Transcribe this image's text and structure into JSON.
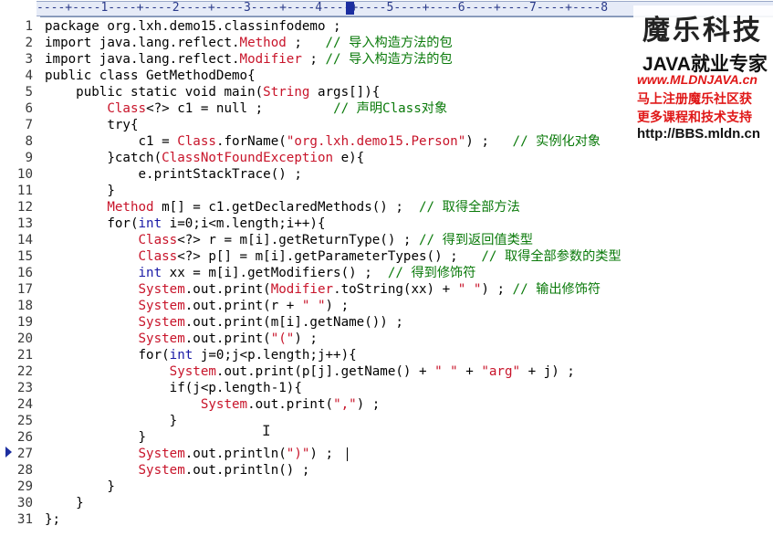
{
  "ruler": {
    "text": "----+----1----+----2----+----3----+----4----+----5----+----6----+----7----+----8"
  },
  "watermark": {
    "logo": "魔乐科技",
    "java": "JAVA就业专家",
    "url": "www.MLDNJAVA.cn",
    "line1": "马上注册魔乐社区获",
    "line2": "更多课程和技术支持",
    "bbs": "http://BBS.mldn.cn"
  },
  "editor": {
    "bookmark_line": 27,
    "lines": [
      {
        "n": "1",
        "seg": [
          {
            "t": "package org.lxh.demo15.classinfodemo ;",
            "c": ""
          }
        ]
      },
      {
        "n": "2",
        "seg": [
          {
            "t": "import java.lang.reflect.",
            "c": ""
          },
          {
            "t": "Method",
            "c": "ty"
          },
          {
            "t": " ;   ",
            "c": ""
          },
          {
            "t": "// 导入构造方法的包",
            "c": "cm"
          }
        ]
      },
      {
        "n": "3",
        "seg": [
          {
            "t": "import java.lang.reflect.",
            "c": ""
          },
          {
            "t": "Modifier",
            "c": "ty"
          },
          {
            "t": " ; ",
            "c": ""
          },
          {
            "t": "// 导入构造方法的包",
            "c": "cm"
          }
        ]
      },
      {
        "n": "4",
        "seg": [
          {
            "t": "public class GetMethodDemo{",
            "c": ""
          }
        ]
      },
      {
        "n": "5",
        "seg": [
          {
            "t": "    public static void main(",
            "c": ""
          },
          {
            "t": "String",
            "c": "ty"
          },
          {
            "t": " args[]){",
            "c": ""
          }
        ]
      },
      {
        "n": "6",
        "seg": [
          {
            "t": "        ",
            "c": ""
          },
          {
            "t": "Class",
            "c": "ty"
          },
          {
            "t": "<?> c1 = null ;         ",
            "c": ""
          },
          {
            "t": "// 声明Class对象",
            "c": "cm"
          }
        ]
      },
      {
        "n": "7",
        "seg": [
          {
            "t": "        try{",
            "c": ""
          }
        ]
      },
      {
        "n": "8",
        "seg": [
          {
            "t": "            c1 = ",
            "c": ""
          },
          {
            "t": "Class",
            "c": "ty"
          },
          {
            "t": ".forName(",
            "c": ""
          },
          {
            "t": "\"org.lxh.demo15.Person\"",
            "c": "st"
          },
          {
            "t": ") ;   ",
            "c": ""
          },
          {
            "t": "// 实例化对象",
            "c": "cm"
          }
        ]
      },
      {
        "n": "9",
        "seg": [
          {
            "t": "        }catch(",
            "c": ""
          },
          {
            "t": "ClassNotFoundException",
            "c": "ty"
          },
          {
            "t": " e){",
            "c": ""
          }
        ]
      },
      {
        "n": "10",
        "seg": [
          {
            "t": "            e.printStackTrace() ;",
            "c": ""
          }
        ]
      },
      {
        "n": "11",
        "seg": [
          {
            "t": "        }",
            "c": ""
          }
        ]
      },
      {
        "n": "12",
        "seg": [
          {
            "t": "        ",
            "c": ""
          },
          {
            "t": "Method",
            "c": "ty"
          },
          {
            "t": " m[] = c1.getDeclaredMethods() ;  ",
            "c": ""
          },
          {
            "t": "// 取得全部方法",
            "c": "cm"
          }
        ]
      },
      {
        "n": "13",
        "seg": [
          {
            "t": "        for(",
            "c": ""
          },
          {
            "t": "int",
            "c": "kw"
          },
          {
            "t": " i=0;i<m.length;i++){",
            "c": ""
          }
        ]
      },
      {
        "n": "14",
        "seg": [
          {
            "t": "            ",
            "c": ""
          },
          {
            "t": "Class",
            "c": "ty"
          },
          {
            "t": "<?> r = m[i].getReturnType() ; ",
            "c": ""
          },
          {
            "t": "// 得到返回值类型",
            "c": "cm"
          }
        ]
      },
      {
        "n": "15",
        "seg": [
          {
            "t": "            ",
            "c": ""
          },
          {
            "t": "Class",
            "c": "ty"
          },
          {
            "t": "<?> p[] = m[i].getParameterTypes() ;   ",
            "c": ""
          },
          {
            "t": "// 取得全部参数的类型",
            "c": "cm"
          }
        ]
      },
      {
        "n": "16",
        "seg": [
          {
            "t": "            ",
            "c": ""
          },
          {
            "t": "int",
            "c": "kw"
          },
          {
            "t": " xx = m[i].getModifiers() ;  ",
            "c": ""
          },
          {
            "t": "// 得到修饰符",
            "c": "cm"
          }
        ]
      },
      {
        "n": "17",
        "seg": [
          {
            "t": "            ",
            "c": ""
          },
          {
            "t": "System",
            "c": "ty"
          },
          {
            "t": ".out.print(",
            "c": ""
          },
          {
            "t": "Modifier",
            "c": "ty"
          },
          {
            "t": ".toString(xx) + ",
            "c": ""
          },
          {
            "t": "\" \"",
            "c": "st"
          },
          {
            "t": ") ; ",
            "c": ""
          },
          {
            "t": "// 输出修饰符",
            "c": "cm"
          }
        ]
      },
      {
        "n": "18",
        "seg": [
          {
            "t": "            ",
            "c": ""
          },
          {
            "t": "System",
            "c": "ty"
          },
          {
            "t": ".out.print(r + ",
            "c": ""
          },
          {
            "t": "\" \"",
            "c": "st"
          },
          {
            "t": ") ;",
            "c": ""
          }
        ]
      },
      {
        "n": "19",
        "seg": [
          {
            "t": "            ",
            "c": ""
          },
          {
            "t": "System",
            "c": "ty"
          },
          {
            "t": ".out.print(m[i].getName()) ;",
            "c": ""
          }
        ]
      },
      {
        "n": "20",
        "seg": [
          {
            "t": "            ",
            "c": ""
          },
          {
            "t": "System",
            "c": "ty"
          },
          {
            "t": ".out.print(",
            "c": ""
          },
          {
            "t": "\"(\"",
            "c": "st"
          },
          {
            "t": ") ;",
            "c": ""
          }
        ]
      },
      {
        "n": "21",
        "seg": [
          {
            "t": "            for(",
            "c": ""
          },
          {
            "t": "int",
            "c": "kw"
          },
          {
            "t": " j=0;j<p.length;j++){",
            "c": ""
          }
        ]
      },
      {
        "n": "22",
        "seg": [
          {
            "t": "                ",
            "c": ""
          },
          {
            "t": "System",
            "c": "ty"
          },
          {
            "t": ".out.print(p[j].getName() + ",
            "c": ""
          },
          {
            "t": "\" \"",
            "c": "st"
          },
          {
            "t": " + ",
            "c": ""
          },
          {
            "t": "\"arg\"",
            "c": "st"
          },
          {
            "t": " + j) ;",
            "c": ""
          }
        ]
      },
      {
        "n": "23",
        "seg": [
          {
            "t": "                if(j<p.length-1){",
            "c": ""
          }
        ]
      },
      {
        "n": "24",
        "seg": [
          {
            "t": "                    ",
            "c": ""
          },
          {
            "t": "System",
            "c": "ty"
          },
          {
            "t": ".out.print(",
            "c": ""
          },
          {
            "t": "\",\"",
            "c": "st"
          },
          {
            "t": ") ;",
            "c": ""
          }
        ]
      },
      {
        "n": "25",
        "seg": [
          {
            "t": "                }",
            "c": ""
          }
        ]
      },
      {
        "n": "26",
        "seg": [
          {
            "t": "            }",
            "c": ""
          }
        ]
      },
      {
        "n": "27",
        "seg": [
          {
            "t": "            ",
            "c": ""
          },
          {
            "t": "System",
            "c": "ty"
          },
          {
            "t": ".out.println(",
            "c": ""
          },
          {
            "t": "\")\"",
            "c": "st"
          },
          {
            "t": ") ;",
            "c": ""
          }
        ]
      },
      {
        "n": "28",
        "seg": [
          {
            "t": "            ",
            "c": ""
          },
          {
            "t": "System",
            "c": "ty"
          },
          {
            "t": ".out.println() ;",
            "c": ""
          }
        ]
      },
      {
        "n": "29",
        "seg": [
          {
            "t": "        }",
            "c": ""
          }
        ]
      },
      {
        "n": "30",
        "seg": [
          {
            "t": "    }",
            "c": ""
          }
        ]
      },
      {
        "n": "31",
        "seg": [
          {
            "t": "};",
            "c": ""
          }
        ]
      }
    ]
  }
}
